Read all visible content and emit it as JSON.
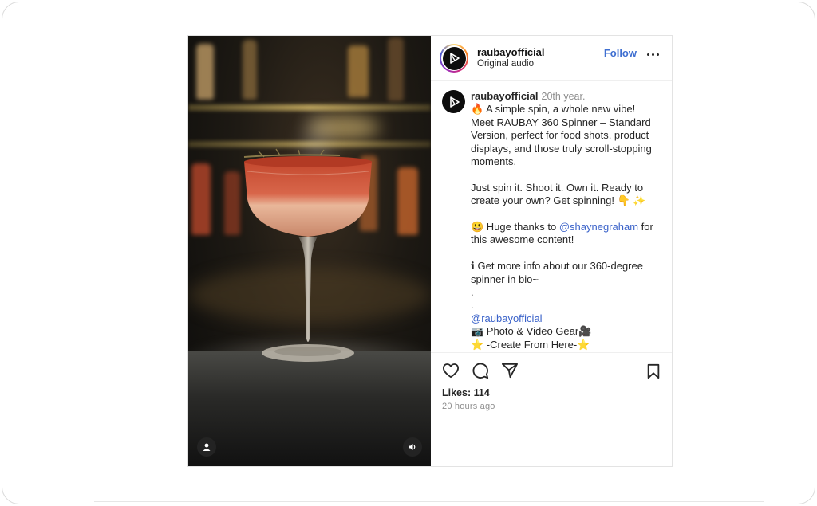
{
  "account": {
    "username": "raubayofficial",
    "audio_label": "Original audio",
    "follow_label": "Follow"
  },
  "caption": {
    "username": "raubayofficial",
    "time": "20th year.",
    "lines": [
      "🔥  A simple spin, a whole new vibe!",
      "Meet RAUBAY 360 Spinner – Standard Version, perfect for food shots, product displays, and those truly scroll-stopping moments."
    ],
    "para2": "Just spin it. Shoot it. Own it. Ready to create your own? Get spinning! 👇 ✨",
    "thanks_prefix": "😃  Huge thanks to ",
    "thanks_mention": "@shaynegraham",
    "thanks_suffix": " for this awesome content!",
    "info_line": "ℹ Get more info about our 360-degree spinner in bio~",
    "dot1": ".",
    "dot2": ".",
    "tag": "@raubayofficial",
    "gear_line": "📷 Photo & Video Gear🎥",
    "create_line": "⭐ -Create From Here-⭐"
  },
  "stats": {
    "likes_label": "Likes: 114",
    "posted_ago": "20 hours ago"
  },
  "icons": {
    "like": "heart-icon",
    "comment": "comment-icon",
    "share": "send-icon",
    "save": "bookmark-icon",
    "tagged": "user-tag-icon",
    "audio": "speaker-icon",
    "more": "more-dots-icon",
    "brand": "raubay-logo-icon"
  },
  "colors": {
    "follow_blue": "#3f6fd1",
    "mention_blue": "#3a62c9",
    "muted_gray": "#8e8e8e"
  }
}
